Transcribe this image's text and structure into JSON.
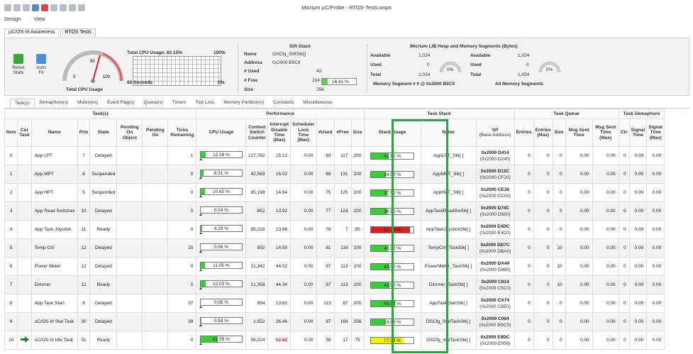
{
  "app": {
    "title": "Micriµm µC/Probe - RTOS-Tests.wspx"
  },
  "menu": [
    "Design",
    "View"
  ],
  "doc_tabs": [
    "µC/OS-III Awareness",
    "RTOS Tests"
  ],
  "ribbon": {
    "reset_label": "Reset\nStats",
    "autofit_label": "Auto\nFit",
    "gauge_labels": {
      "g0": "0",
      "g50": "50",
      "g100": "100"
    },
    "total_cpu_usage_label": "Total CPU Usage",
    "total_cpu_usage_text": "Total CPU Usage: 62.15%",
    "chart_top": "100%",
    "chart_bottom": "0%",
    "chart_seconds": "60 Seconds",
    "isr": {
      "title": "ISR Stack",
      "name_label": "Name",
      "name_value": "OSCfg_ISRStk[]",
      "address_label": "Address",
      "address_value": "0x2000 B9C0",
      "used_label": "# Used",
      "used_value": "42",
      "free_label": "# Free",
      "free_value": "214",
      "free_pct": "16.41 %",
      "free_fraction": 0.1641,
      "size_label": "Size",
      "size_value": "256"
    },
    "heap": {
      "title": "Micrium LIB Heap and Memory Segments (Bytes)",
      "left": {
        "available_label": "Available",
        "available_value": "1,024",
        "used_label": "Used",
        "used_value": "0",
        "total_label": "Total",
        "total_value": "1,024",
        "pct": "0%"
      },
      "right": {
        "available_label": "Available",
        "available_value": "1,024",
        "used_label": "Used",
        "used_value": "0",
        "total_label": "Total",
        "total_value": "1,024",
        "pct": "0%"
      },
      "segment_left": "Memory Segment # 0 @ 0x2000 B5C0",
      "segment_right": "All Memory Segments"
    }
  },
  "sub_tabs": [
    "Task(s)",
    "Semaphore(s)",
    "Mutex(es)",
    "Event Flag(s)",
    "Queue(s)",
    "Timers",
    "Tick Lists",
    "Memory Partition(s)",
    "Constants",
    "Miscellaneous"
  ],
  "groups": {
    "tasks": "Task(s)",
    "performance": "Performance",
    "stack": "Task Stack",
    "queue": "Task Queue",
    "sem": "Task Semaphore"
  },
  "columns": {
    "item": "Item",
    "cur": "Cur Task",
    "name": "Name",
    "prio": "Prio",
    "state": "State",
    "pend_obj": "Pending On Object",
    "pend_on": "Pending On",
    "ticks": "Ticks Remaining",
    "cpu": "CPU Usage",
    "ctx": "Context Switch Counter",
    "irq": "Interrupt Disable Time (Max)",
    "sched": "Scheduler Lock Time (Max)",
    "used": "#Used",
    "free": "#Free",
    "size": "Size",
    "stk_usage": "Stack Usage",
    "stk_name": "Name",
    "sp": "SP",
    "sp_sub": "(Base Address)",
    "entries": "Entries",
    "entries_max": "Entries (Max)",
    "qsize": "Size",
    "msg_sent": "Msg Sent Time",
    "msg_sent_max": "Msg Sent Time (Max)",
    "ctr": "Ctr",
    "sig_time": "Signal Time",
    "sig_max": "Signal Time (Max)"
  },
  "rows": [
    {
      "item": "0",
      "name": "App LPT",
      "prio": "7",
      "state": "Delayed",
      "ticks": "1",
      "cpu": "12.28 %",
      "cpu_f": 0.1228,
      "ctx": "127,762",
      "irq": "15.12",
      "sched": "0.00",
      "used": "83",
      "free": "117",
      "size": "200",
      "stk": "41.50 %",
      "stk_f": 0.415,
      "stk_color": "#35d035",
      "stk_name": "AppLPT_Stk[ ]",
      "sp1": "0x2000 D414",
      "sp2": "(0x2000 D240)",
      "q1": "0",
      "q2": "0",
      "q3": "0",
      "q4": "0.00",
      "q5": "0.00",
      "ctr": "0",
      "s1": "0.00",
      "s2": "0.00"
    },
    {
      "item": "1",
      "name": "App MPT",
      "prio": "6",
      "state": "Suspended",
      "ticks": "0",
      "cpu": "6.31 %",
      "cpu_f": 0.0631,
      "ctx": "42,593",
      "irq": "15.02",
      "sched": "0.00",
      "used": "69",
      "free": "131",
      "size": "200",
      "stk": "34.50 %",
      "stk_f": 0.345,
      "stk_color": "#35d035",
      "stk_name": "AppMPT_Stk[ ]",
      "sp1": "0x2000 D12C",
      "sp2": "(0x2000 CF20)",
      "q1": "0",
      "q2": "0",
      "q3": "0",
      "q4": "0.00",
      "q5": "0.00",
      "ctr": "0",
      "s1": "0.00",
      "s2": "0.00"
    },
    {
      "item": "2",
      "name": "App HPT",
      "prio": "5",
      "state": "Suspended",
      "ticks": "0",
      "cpu": "10.62 %",
      "cpu_f": 0.1062,
      "ctx": "85,198",
      "irq": "14.94",
      "sched": "0.00",
      "used": "75",
      "free": "125",
      "size": "200",
      "stk": "37.50 %",
      "stk_f": 0.375,
      "stk_color": "#35d035",
      "stk_name": "AppHPT_Stk[ ]",
      "sp1": "0x2000 CE34",
      "sp2": "(0x2000 CC00)",
      "q1": "0",
      "q2": "0",
      "q3": "0",
      "q4": "0.00",
      "q5": "0.00",
      "ctr": "0",
      "s1": "0.00",
      "s2": "0.00"
    },
    {
      "item": "3",
      "name": "App Read Switches",
      "prio": "10",
      "state": "Delayed",
      "ticks": "0",
      "cpu": "0.04 %",
      "cpu_f": 0.0004,
      "ctx": "852",
      "irq": "13.92",
      "sched": "0.00",
      "used": "77",
      "free": "123",
      "size": "200",
      "stk": "38.50 %",
      "stk_f": 0.385,
      "stk_color": "#35d035",
      "stk_name": "AppTaskReadSwStk[ ]",
      "sp1": "0x2000 D74C",
      "sp2": "(0x2000 D560)",
      "q1": "0",
      "q2": "0",
      "q3": "0",
      "q4": "0.00",
      "q5": "0.00",
      "ctr": "0",
      "s1": "0.00",
      "s2": "0.00"
    },
    {
      "item": "4",
      "name": "App Task Joystick",
      "prio": "11",
      "state": "Ready",
      "ticks": "0",
      "cpu": "4.29 %",
      "cpu_f": 0.0429,
      "ctx": "85,218",
      "irq": "13.98",
      "sched": "0.00",
      "used": "78",
      "free": "7",
      "size": "85",
      "stk": "91.76 %",
      "stk_f": 0.9176,
      "stk_color": "#e01c1c",
      "stk_name": "AppTaskJoystickStk[ ]",
      "sp1": "0x2000 E4DC",
      "sp2": "(0x2000 E4C0)",
      "q1": "0",
      "q2": "0",
      "q3": "0",
      "q4": "0.00",
      "q5": "0.00",
      "ctr": "0",
      "s1": "0.00",
      "s2": "0.00"
    },
    {
      "item": "5",
      "name": "Temp Ctrl",
      "prio": "12",
      "state": "Delayed",
      "ticks": "15",
      "cpu": "0.06 %",
      "cpu_f": 0.0006,
      "ctx": "852",
      "irq": "14.50",
      "sched": "0.00",
      "used": "81",
      "free": "119",
      "size": "200",
      "stk": "40.50 %",
      "stk_f": 0.405,
      "stk_color": "#35d035",
      "stk_name": "TempCtrl_TaskStk[ ]",
      "sp1": "0x2000 DD7C",
      "sp2": "(0x2000 DBA0)",
      "q1": "0",
      "q2": "0",
      "q3": "10",
      "q4": "0.00",
      "q5": "0.00",
      "ctr": "0",
      "s1": "0.00",
      "s2": "0.00"
    },
    {
      "item": "6",
      "name": "Power Meter",
      "prio": "12",
      "state": "Delayed",
      "ticks": "0",
      "cpu": "11.05 %",
      "cpu_f": 0.1105,
      "ctx": "21,342",
      "irq": "44.02",
      "sched": "0.00",
      "used": "87",
      "free": "113",
      "size": "200",
      "stk": "43.50 %",
      "stk_f": 0.435,
      "stk_color": "#35d035",
      "stk_name": "PowerMeter_TaskStk[ ]",
      "sp1": "0x2000 DA44",
      "sp2": "(0x2000 D880)",
      "q1": "0",
      "q2": "0",
      "q3": "10",
      "q4": "0.00",
      "q5": "0.00",
      "ctr": "0",
      "s1": "0.00",
      "s2": "0.00"
    },
    {
      "item": "7",
      "name": "Dimmer",
      "prio": "12",
      "state": "Ready",
      "ticks": "0",
      "cpu": "12.02 %",
      "cpu_f": 0.1202,
      "ctx": "21,358",
      "irq": "44.34",
      "sched": "0.00",
      "used": "87",
      "free": "113",
      "size": "200",
      "stk": "43.50 %",
      "stk_f": 0.435,
      "stk_color": "#35d035",
      "stk_name": "Dimmer_TaskStk[ ]",
      "sp1": "0x2000 C814",
      "sp2": "(0x2000 C5C0)",
      "q1": "0",
      "q2": "0",
      "q3": "10",
      "q4": "0.00",
      "q5": "0.00",
      "ctr": "0",
      "s1": "0.00",
      "s2": "0.00"
    },
    {
      "item": "8",
      "name": "App Task Start",
      "prio": "8",
      "state": "Delayed",
      "ticks": "37",
      "cpu": "0.05 %",
      "cpu_f": 0.0005,
      "ctx": "854",
      "irq": "13.62",
      "sched": "0.00",
      "used": "113",
      "free": "87",
      "size": "200",
      "stk": "56.50 %",
      "stk_f": 0.565,
      "stk_color": "#35d035",
      "stk_name": "AppTaskStartStk[ ]",
      "sp1": "0x2000 CA74",
      "sp2": "(0x2000 C8E0)",
      "q1": "0",
      "q2": "0",
      "q3": "0",
      "q4": "0.00",
      "q5": "0.00",
      "ctr": "0",
      "s1": "0.00",
      "s2": "0.00"
    },
    {
      "item": "9",
      "name": "uC/OS-III Stat Task",
      "prio": "30",
      "state": "Delayed",
      "ticks": "39",
      "cpu": "0.53 %",
      "cpu_f": 0.0053,
      "ctx": "1,552",
      "irq": "26.46",
      "sched": "0.00",
      "used": "87",
      "free": "169",
      "size": "256",
      "stk": "33.98 %",
      "stk_f": 0.3398,
      "stk_color": "#35d035",
      "stk_name": "OSCfg_StatTaskStk[ ]",
      "sp1": "0x2000 C064",
      "sp2": "(0x2000 BDC0)",
      "q1": "0",
      "q2": "0",
      "q3": "0",
      "q4": "0.00",
      "q5": "0.00",
      "ctr": "0",
      "s1": "0.00",
      "s2": "0.00"
    },
    {
      "item": "10",
      "cur": true,
      "name": "uC/OS-III Idle Task",
      "prio": "31",
      "state": "Ready",
      "ticks": "0",
      "cpu": "41.05 %",
      "cpu_f": 0.4105,
      "ctx": "56,224",
      "irq": "52.62",
      "irq_red": true,
      "sched": "0.00",
      "used": "58",
      "free": "17",
      "size": "75",
      "stk": "77.33 %",
      "stk_f": 0.7733,
      "stk_color": "#f2f200",
      "stk_name": "OSCfg_IdleTaskStk[ ]",
      "sp1": "0x2000 E9DC",
      "sp2": "(0x2000 E950)",
      "q1": "0",
      "q2": "0",
      "q3": "0",
      "q4": "0.00",
      "q5": "0.00",
      "ctr": "0",
      "s1": "0.00",
      "s2": "0.00"
    }
  ]
}
